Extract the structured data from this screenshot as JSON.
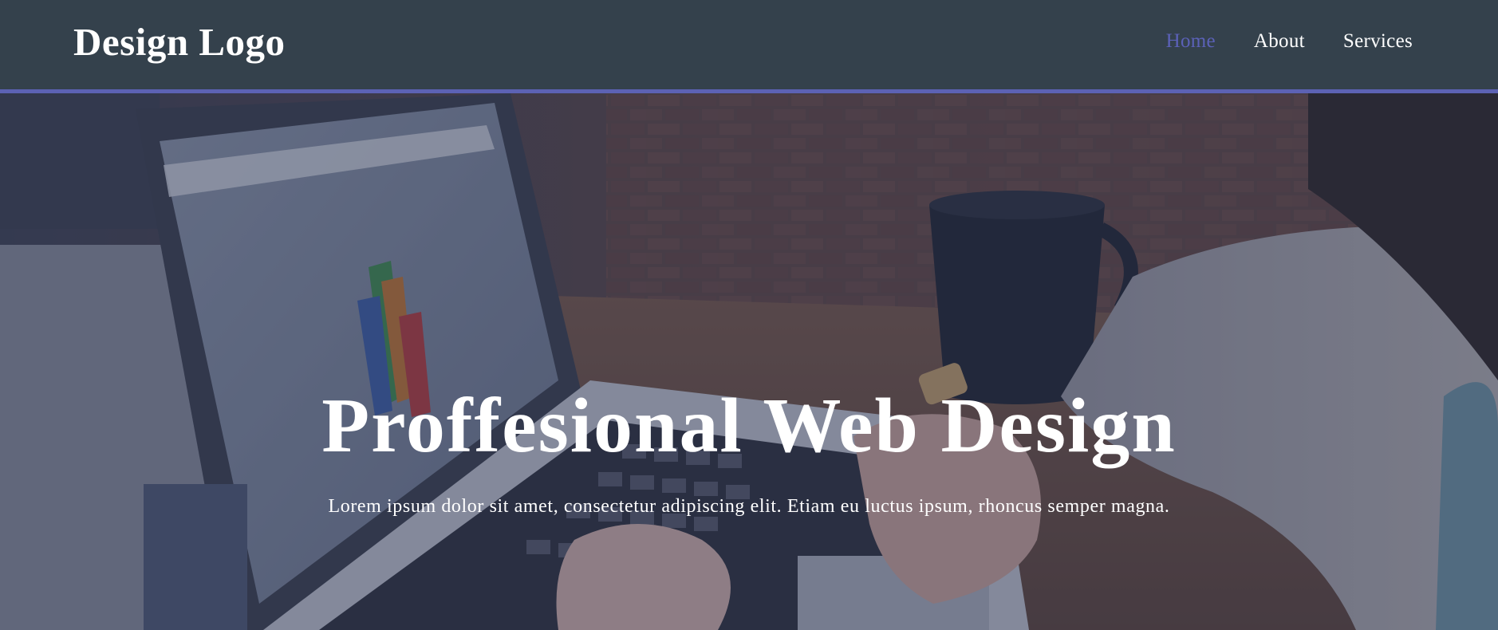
{
  "header": {
    "logo": "Design Logo",
    "nav": [
      {
        "label": "Home",
        "active": true
      },
      {
        "label": "About",
        "active": false
      },
      {
        "label": "Services",
        "active": false
      }
    ]
  },
  "hero": {
    "title": "Proffesional Web Design",
    "text": "Lorem ipsum dolor sit amet, consectetur adipiscing elit. Etiam eu luctus ipsum, rhoncus semper magna."
  },
  "colors": {
    "header_bg": "#34414c",
    "accent": "#5c62b4",
    "active_link": "#5b61b8",
    "text": "#ffffff"
  }
}
